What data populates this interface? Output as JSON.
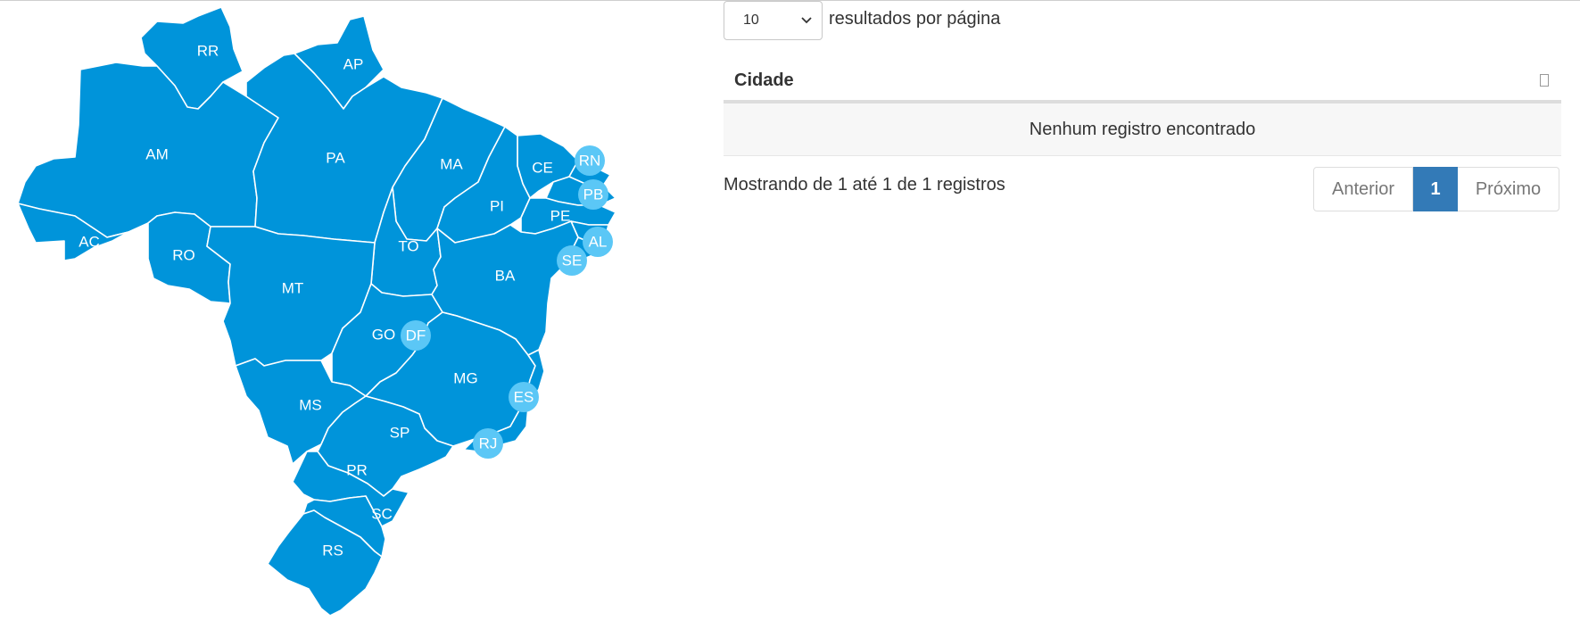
{
  "map": {
    "fill_color": "#0094da",
    "bubble_color": "#5bc7f6",
    "states": [
      {
        "code": "RR"
      },
      {
        "code": "AP"
      },
      {
        "code": "AM"
      },
      {
        "code": "PA"
      },
      {
        "code": "MA"
      },
      {
        "code": "CE"
      },
      {
        "code": "RN"
      },
      {
        "code": "PB"
      },
      {
        "code": "PI"
      },
      {
        "code": "PE"
      },
      {
        "code": "AL"
      },
      {
        "code": "SE"
      },
      {
        "code": "AC"
      },
      {
        "code": "RO"
      },
      {
        "code": "TO"
      },
      {
        "code": "BA"
      },
      {
        "code": "MT"
      },
      {
        "code": "GO"
      },
      {
        "code": "DF"
      },
      {
        "code": "MG"
      },
      {
        "code": "ES"
      },
      {
        "code": "MS"
      },
      {
        "code": "SP"
      },
      {
        "code": "RJ"
      },
      {
        "code": "PR"
      },
      {
        "code": "SC"
      },
      {
        "code": "RS"
      }
    ]
  },
  "length": {
    "selected": "10",
    "label": "resultados por página"
  },
  "table": {
    "column_header": "Cidade",
    "empty_message": "Nenhum registro encontrado"
  },
  "info": "Mostrando de 1 até 1 de 1 registros",
  "pagination": {
    "previous": "Anterior",
    "current_page": "1",
    "next": "Próximo",
    "active_color": "#337ab7"
  }
}
